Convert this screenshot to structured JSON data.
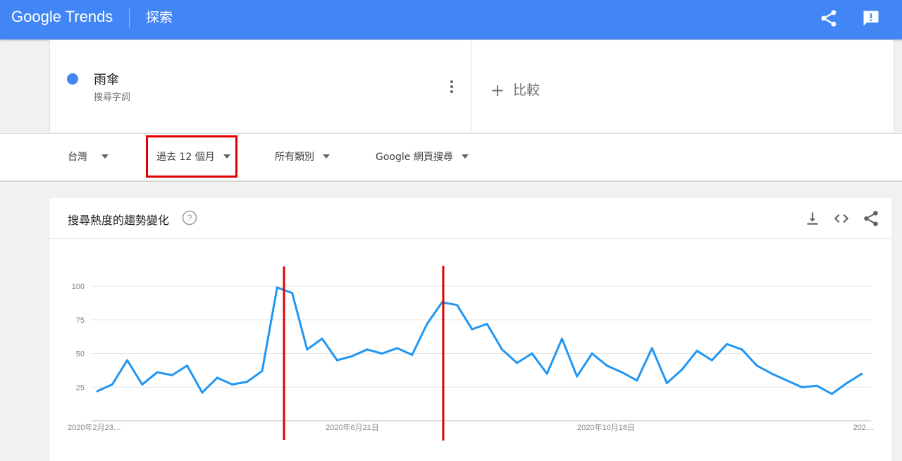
{
  "header": {
    "logo": "Google Trends",
    "title": "探索"
  },
  "term": {
    "name": "雨傘",
    "type": "搜尋字詞",
    "color": "#4285f4"
  },
  "compare": {
    "label": "比較"
  },
  "filters": {
    "region": "台灣",
    "time": "過去 12 個月",
    "category": "所有類別",
    "source": "Google 網頁搜尋"
  },
  "chart_card": {
    "title": "搜尋熱度的趨勢變化"
  },
  "chart_data": {
    "type": "line",
    "y_ticks": [
      100,
      75,
      50,
      25
    ],
    "ylim": [
      0,
      100
    ],
    "x_labels": [
      "2020年2月23…",
      "2020年6月21日",
      "2020年10月18日",
      "202…"
    ],
    "series": [
      {
        "color": "#2196f3",
        "values": [
          22,
          27,
          45,
          27,
          36,
          34,
          41,
          21,
          32,
          27,
          29,
          37,
          99,
          95,
          53,
          61,
          45,
          48,
          53,
          50,
          54,
          49,
          72,
          88,
          86,
          68,
          72,
          53,
          43,
          50,
          35,
          61,
          33,
          50,
          41,
          36,
          30,
          54,
          28,
          38,
          52,
          45,
          57,
          53,
          41,
          35,
          30,
          25,
          26,
          20,
          28,
          35
        ]
      }
    ],
    "annotation_color": "#e10000",
    "grid": true
  }
}
